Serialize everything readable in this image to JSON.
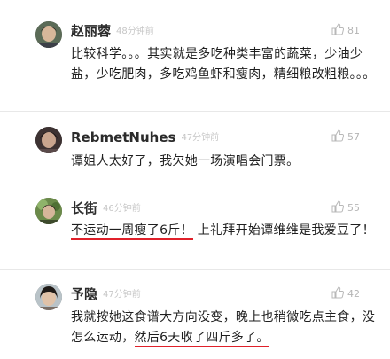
{
  "comments": [
    {
      "name": "赵丽蓉",
      "time": "48分钟前",
      "likes": "81",
      "text": "比较科学。。。其实就是多吃种类丰富的蔬菜，少油少盐，少吃肥肉，多吃鸡鱼虾和瘦肉，精细粮改粗粮。。。"
    },
    {
      "name": "RebmetNuhes",
      "time": "47分钟前",
      "likes": "57",
      "text": "谭姐人太好了，我欠她一场演唱会门票。"
    },
    {
      "name": "长街",
      "time": "46分钟前",
      "likes": "55",
      "text_highlight": "不运动一周瘦了6斤！",
      "text_rest": "上礼拜开始谭维维是我爱豆了！"
    },
    {
      "name": "予隐",
      "time": "47分钟前",
      "likes": "42",
      "text_before": "我就按她这食谱大方向没变，晚上也稍微吃点主食，没怎么运动，",
      "text_highlight": "然后6天收了四斤多了。"
    }
  ],
  "colors": {
    "highlight_underline": "#e0202a"
  },
  "icons": {
    "like": "thumbs-up-icon"
  }
}
